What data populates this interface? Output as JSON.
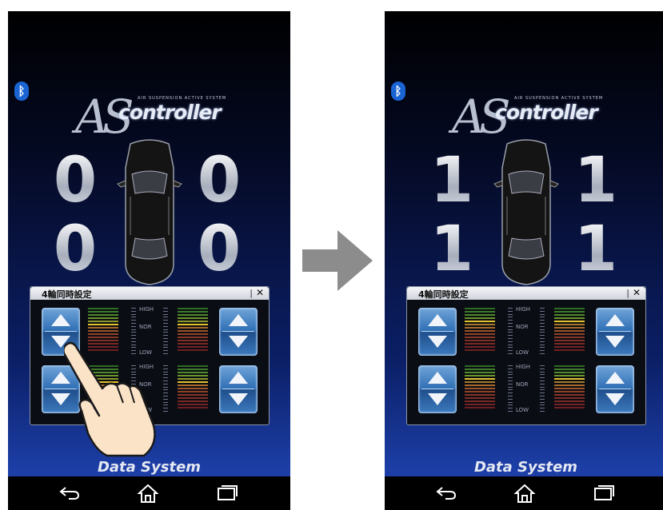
{
  "arrow_label": "",
  "screens": [
    {
      "id": "before",
      "logo": {
        "a": "AS",
        "word": "controller",
        "tagline": "AIR SUSPENSION ACTIVE SYSTEM"
      },
      "heights": {
        "front_left": "0",
        "front_right": "0",
        "rear_left": "0",
        "rear_right": "0"
      },
      "panel": {
        "title": "4輪同時設定",
        "bar": "|",
        "close": "✕"
      },
      "scale_labels": {
        "high": "HIGH",
        "nor": "NOR",
        "low": "LOW"
      },
      "brand": "Data System",
      "show_hand": true
    },
    {
      "id": "after",
      "logo": {
        "a": "AS",
        "word": "controller",
        "tagline": "AIR SUSPENSION ACTIVE SYSTEM"
      },
      "heights": {
        "front_left": "1",
        "front_right": "1",
        "rear_left": "1",
        "rear_right": "1"
      },
      "panel": {
        "title": "4輪同時設定",
        "bar": "|",
        "close": "✕"
      },
      "scale_labels": {
        "high": "HIGH",
        "nor": "NOR",
        "low": "LOW"
      },
      "brand": "Data System",
      "show_hand": false
    }
  ],
  "icons": {
    "bluetooth": "bluetooth-icon",
    "back": "back-icon",
    "home": "home-icon",
    "recent": "recent-apps-icon",
    "up": "up-arrow-icon",
    "down": "down-arrow-icon"
  },
  "colors": {
    "bg_top": "#000000",
    "bg_bottom": "#1c3ea6",
    "button_blue": "#2f6fb5",
    "arrow_gray": "#8c8c8c"
  }
}
